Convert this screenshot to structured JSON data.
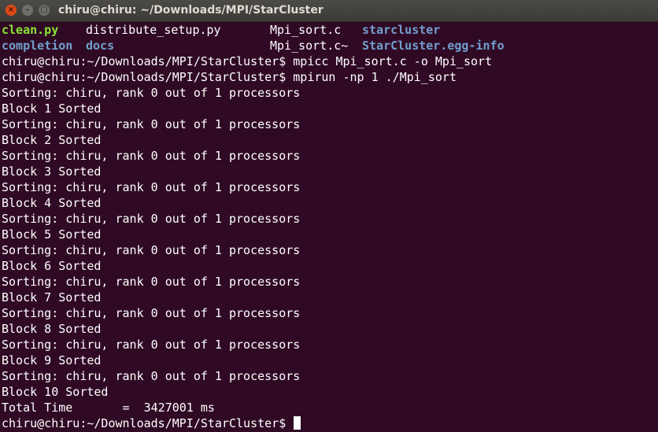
{
  "window": {
    "title": "chiru@chiru: ~/Downloads/MPI/StarCluster",
    "close_glyph": "×",
    "min_glyph": "–",
    "max_glyph": "□"
  },
  "ls": {
    "row1": [
      "clean.py",
      "distribute_setup.py",
      "Mpi_sort.c",
      "starcluster"
    ],
    "row2": [
      "completion",
      "docs",
      "Mpi_sort.c~",
      "StarCluster.egg-info"
    ]
  },
  "lines": [
    "chiru@chiru:~/Downloads/MPI/StarCluster$ mpicc Mpi_sort.c -o Mpi_sort",
    "chiru@chiru:~/Downloads/MPI/StarCluster$ mpirun -np 1 ./Mpi_sort",
    "Sorting: chiru, rank 0 out of 1 processors",
    "Block 1 Sorted",
    "Sorting: chiru, rank 0 out of 1 processors",
    "Block 2 Sorted",
    "Sorting: chiru, rank 0 out of 1 processors",
    "Block 3 Sorted",
    "Sorting: chiru, rank 0 out of 1 processors",
    "Block 4 Sorted",
    "Sorting: chiru, rank 0 out of 1 processors",
    "Block 5 Sorted",
    "Sorting: chiru, rank 0 out of 1 processors",
    "Block 6 Sorted",
    "Sorting: chiru, rank 0 out of 1 processors",
    "Block 7 Sorted",
    "Sorting: chiru, rank 0 out of 1 processors",
    "Block 8 Sorted",
    "Sorting: chiru, rank 0 out of 1 processors",
    "Block 9 Sorted",
    "Sorting: chiru, rank 0 out of 1 processors",
    "Block 10 Sorted",
    "Total Time       =  3427001 ms"
  ],
  "prompt": "chiru@chiru:~/Downloads/MPI/StarCluster$ ",
  "colors": {
    "background": "#300a24",
    "executable": "#8ae234",
    "directory": "#729fcf",
    "text": "#ffffff"
  }
}
